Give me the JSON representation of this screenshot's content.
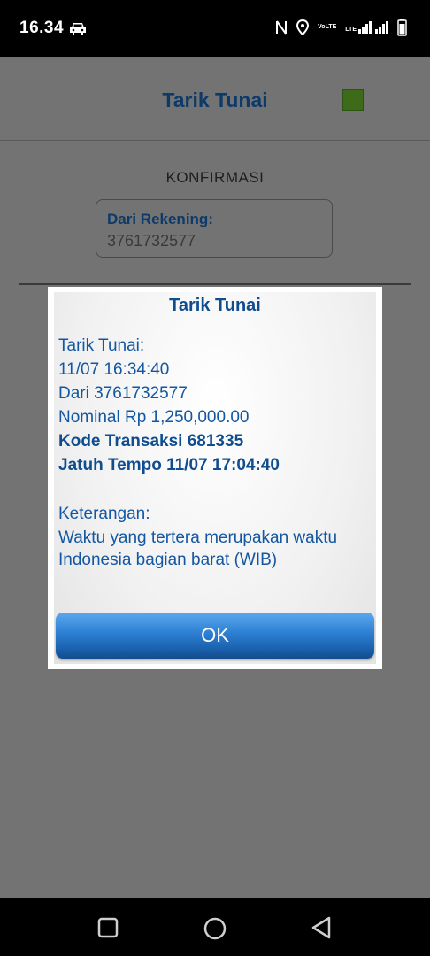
{
  "status_bar": {
    "time": "16.34",
    "icons": [
      "car-icon",
      "nfc-icon",
      "location-icon",
      "volte-icon",
      "signal-icon",
      "battery-icon"
    ],
    "network_labels": [
      "VoLTE",
      "LTE"
    ]
  },
  "header": {
    "title": "Tarik Tunai"
  },
  "confirmation": {
    "heading": "KONFIRMASI",
    "account_label": "Dari Rekening:",
    "account_value": "3761732577"
  },
  "dialog": {
    "title": "Tarik Tunai",
    "lines": [
      "Tarik Tunai:",
      "11/07 16:34:40",
      "Dari 3761732577",
      "Nominal Rp 1,250,000.00",
      "Kode Transaksi 681335",
      "Jatuh Tempo 11/07 17:04:40",
      "Keterangan:",
      "Waktu yang tertera merupakan waktu",
      "Indonesia bagian barat (WIB)"
    ],
    "ok_label": "OK"
  },
  "colors": {
    "title_blue": "#0e3a6a",
    "dialog_text": "#1357a3",
    "button_blue": "#2d7fd2",
    "indicator_green": "#3e6b1a",
    "overlay_gray": "#737373"
  }
}
